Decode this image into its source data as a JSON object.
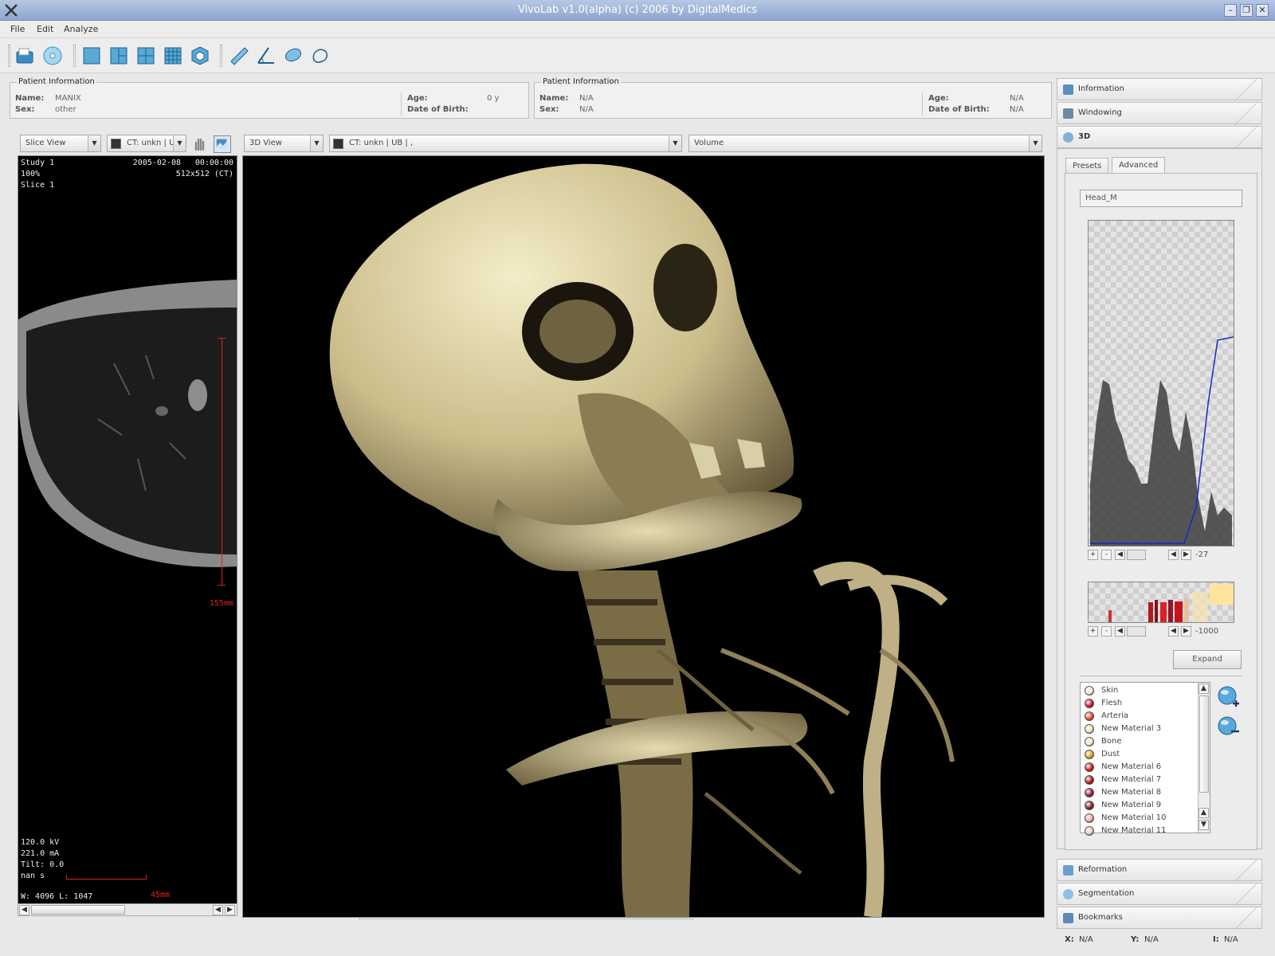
{
  "window": {
    "title": "VivoLab v1.0(alpha)        (c) 2006 by DigitalMedics"
  },
  "menu": [
    "File",
    "Edit",
    "Analyze"
  ],
  "toolbar": {
    "icons": [
      "open-folder-icon",
      "cd-icon",
      "single-view-icon",
      "split-view-icon",
      "quad-view-icon",
      "grid-view-icon",
      "3d-cube-icon",
      "ruler-icon",
      "angle-icon",
      "lasso-icon",
      "freehand-icon"
    ]
  },
  "patient_left": {
    "legend": "Patient Information",
    "name_label": "Name:",
    "name": "MANIX",
    "sex_label": "Sex:",
    "sex": "other",
    "age_label": "Age:",
    "age": "0 y",
    "dob_label": "Date of Birth:",
    "dob": ""
  },
  "patient_right": {
    "legend": "Patient Information",
    "name_label": "Name:",
    "name": "N/A",
    "sex_label": "Sex:",
    "sex": "N/A",
    "age_label": "Age:",
    "age": "N/A",
    "dob_label": "Date of Birth:",
    "dob": "N/A"
  },
  "slice_view": {
    "mode": "Slice View",
    "series": "CT: unkn | U",
    "study": "Study 1",
    "date": "2005-02-08",
    "time": "00:00:00",
    "zoom": "100%",
    "matrix": "512x512 (CT)",
    "slice": "Slice 1",
    "kv": "120.0 kV",
    "ma": "221.0 mA",
    "tilt": "Tilt: 0.0",
    "time_s": "nan s",
    "window": "W: 4096  L: 1047",
    "scale_v": "155mm",
    "scale_h": "45mm"
  },
  "view_3d": {
    "mode": "3D View",
    "series": "CT: unkn | UB | ,",
    "render": "Volume"
  },
  "right_panel": {
    "tabs_top": [
      "Information",
      "Windowing",
      "3D"
    ],
    "subtabs": [
      "Presets",
      "Advanced"
    ],
    "preset_name": "Head_M",
    "opacity_value": "-27",
    "color_value": "-1000",
    "expand_label": "Expand",
    "tabs_bottom": [
      "Reformation",
      "Segmentation",
      "Bookmarks"
    ]
  },
  "materials": [
    {
      "name": "Skin",
      "color": "#f3ecd6"
    },
    {
      "name": "Flesh",
      "color": "#d01030"
    },
    {
      "name": "Arteria",
      "color": "#e0502a"
    },
    {
      "name": "New Material 3",
      "color": "#f1e3b2"
    },
    {
      "name": "Bone",
      "color": "#f3ebc8"
    },
    {
      "name": "Dust",
      "color": "#d4a615"
    },
    {
      "name": "New Material 6",
      "color": "#d81414"
    },
    {
      "name": "New Material 7",
      "color": "#b51010"
    },
    {
      "name": "New Material 8",
      "color": "#9a1430"
    },
    {
      "name": "New Material 9",
      "color": "#7d1a22"
    },
    {
      "name": "New Material 10",
      "color": "#e7a89a"
    },
    {
      "name": "New Material 11",
      "color": "#f0c8b8"
    }
  ],
  "status": {
    "x_label": "X:",
    "x": "N/A",
    "y_label": "Y:",
    "y": "N/A",
    "i_label": "I:",
    "i": "N/A"
  }
}
